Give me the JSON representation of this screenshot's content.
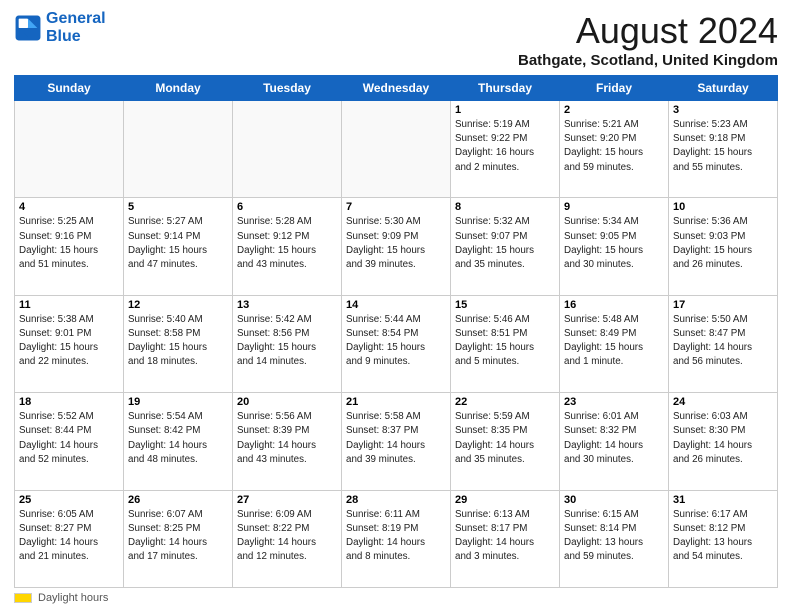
{
  "logo": {
    "line1": "General",
    "line2": "Blue"
  },
  "header": {
    "title": "August 2024",
    "location": "Bathgate, Scotland, United Kingdom"
  },
  "weekdays": [
    "Sunday",
    "Monday",
    "Tuesday",
    "Wednesday",
    "Thursday",
    "Friday",
    "Saturday"
  ],
  "weeks": [
    [
      {
        "day": "",
        "info": ""
      },
      {
        "day": "",
        "info": ""
      },
      {
        "day": "",
        "info": ""
      },
      {
        "day": "",
        "info": ""
      },
      {
        "day": "1",
        "info": "Sunrise: 5:19 AM\nSunset: 9:22 PM\nDaylight: 16 hours\nand 2 minutes."
      },
      {
        "day": "2",
        "info": "Sunrise: 5:21 AM\nSunset: 9:20 PM\nDaylight: 15 hours\nand 59 minutes."
      },
      {
        "day": "3",
        "info": "Sunrise: 5:23 AM\nSunset: 9:18 PM\nDaylight: 15 hours\nand 55 minutes."
      }
    ],
    [
      {
        "day": "4",
        "info": "Sunrise: 5:25 AM\nSunset: 9:16 PM\nDaylight: 15 hours\nand 51 minutes."
      },
      {
        "day": "5",
        "info": "Sunrise: 5:27 AM\nSunset: 9:14 PM\nDaylight: 15 hours\nand 47 minutes."
      },
      {
        "day": "6",
        "info": "Sunrise: 5:28 AM\nSunset: 9:12 PM\nDaylight: 15 hours\nand 43 minutes."
      },
      {
        "day": "7",
        "info": "Sunrise: 5:30 AM\nSunset: 9:09 PM\nDaylight: 15 hours\nand 39 minutes."
      },
      {
        "day": "8",
        "info": "Sunrise: 5:32 AM\nSunset: 9:07 PM\nDaylight: 15 hours\nand 35 minutes."
      },
      {
        "day": "9",
        "info": "Sunrise: 5:34 AM\nSunset: 9:05 PM\nDaylight: 15 hours\nand 30 minutes."
      },
      {
        "day": "10",
        "info": "Sunrise: 5:36 AM\nSunset: 9:03 PM\nDaylight: 15 hours\nand 26 minutes."
      }
    ],
    [
      {
        "day": "11",
        "info": "Sunrise: 5:38 AM\nSunset: 9:01 PM\nDaylight: 15 hours\nand 22 minutes."
      },
      {
        "day": "12",
        "info": "Sunrise: 5:40 AM\nSunset: 8:58 PM\nDaylight: 15 hours\nand 18 minutes."
      },
      {
        "day": "13",
        "info": "Sunrise: 5:42 AM\nSunset: 8:56 PM\nDaylight: 15 hours\nand 14 minutes."
      },
      {
        "day": "14",
        "info": "Sunrise: 5:44 AM\nSunset: 8:54 PM\nDaylight: 15 hours\nand 9 minutes."
      },
      {
        "day": "15",
        "info": "Sunrise: 5:46 AM\nSunset: 8:51 PM\nDaylight: 15 hours\nand 5 minutes."
      },
      {
        "day": "16",
        "info": "Sunrise: 5:48 AM\nSunset: 8:49 PM\nDaylight: 15 hours\nand 1 minute."
      },
      {
        "day": "17",
        "info": "Sunrise: 5:50 AM\nSunset: 8:47 PM\nDaylight: 14 hours\nand 56 minutes."
      }
    ],
    [
      {
        "day": "18",
        "info": "Sunrise: 5:52 AM\nSunset: 8:44 PM\nDaylight: 14 hours\nand 52 minutes."
      },
      {
        "day": "19",
        "info": "Sunrise: 5:54 AM\nSunset: 8:42 PM\nDaylight: 14 hours\nand 48 minutes."
      },
      {
        "day": "20",
        "info": "Sunrise: 5:56 AM\nSunset: 8:39 PM\nDaylight: 14 hours\nand 43 minutes."
      },
      {
        "day": "21",
        "info": "Sunrise: 5:58 AM\nSunset: 8:37 PM\nDaylight: 14 hours\nand 39 minutes."
      },
      {
        "day": "22",
        "info": "Sunrise: 5:59 AM\nSunset: 8:35 PM\nDaylight: 14 hours\nand 35 minutes."
      },
      {
        "day": "23",
        "info": "Sunrise: 6:01 AM\nSunset: 8:32 PM\nDaylight: 14 hours\nand 30 minutes."
      },
      {
        "day": "24",
        "info": "Sunrise: 6:03 AM\nSunset: 8:30 PM\nDaylight: 14 hours\nand 26 minutes."
      }
    ],
    [
      {
        "day": "25",
        "info": "Sunrise: 6:05 AM\nSunset: 8:27 PM\nDaylight: 14 hours\nand 21 minutes."
      },
      {
        "day": "26",
        "info": "Sunrise: 6:07 AM\nSunset: 8:25 PM\nDaylight: 14 hours\nand 17 minutes."
      },
      {
        "day": "27",
        "info": "Sunrise: 6:09 AM\nSunset: 8:22 PM\nDaylight: 14 hours\nand 12 minutes."
      },
      {
        "day": "28",
        "info": "Sunrise: 6:11 AM\nSunset: 8:19 PM\nDaylight: 14 hours\nand 8 minutes."
      },
      {
        "day": "29",
        "info": "Sunrise: 6:13 AM\nSunset: 8:17 PM\nDaylight: 14 hours\nand 3 minutes."
      },
      {
        "day": "30",
        "info": "Sunrise: 6:15 AM\nSunset: 8:14 PM\nDaylight: 13 hours\nand 59 minutes."
      },
      {
        "day": "31",
        "info": "Sunrise: 6:17 AM\nSunset: 8:12 PM\nDaylight: 13 hours\nand 54 minutes."
      }
    ]
  ],
  "footer": {
    "daylight_label": "Daylight hours"
  }
}
